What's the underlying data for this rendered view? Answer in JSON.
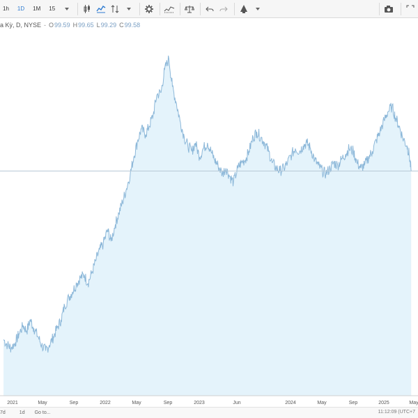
{
  "toolbar": {
    "intervals": [
      "1h",
      "1D",
      "1M",
      "15"
    ],
    "active_interval": "1D"
  },
  "legend": {
    "symbol": "a Kỳ, D, NYSE",
    "dash": "-",
    "open_label": "O",
    "open": "99.59",
    "high_label": "H",
    "high": "99.65",
    "low_label": "L",
    "low": "99.29",
    "close_label": "C",
    "close": "99.58"
  },
  "chart_data": {
    "type": "area",
    "x_tick_labels": [
      "2021",
      "May",
      "Sep",
      "2022",
      "May",
      "Sep",
      "2023",
      "Jun",
      "2024",
      "May",
      "Sep",
      "2025",
      "May"
    ],
    "x_range": [
      "2020-11",
      "2025-05"
    ],
    "y_axis_visible": false,
    "series": [
      {
        "x": [
          "2020-11-15",
          "2020-12-01",
          "2020-12-15",
          "2021-01-01",
          "2021-01-15",
          "2021-02-01",
          "2021-02-15",
          "2021-03-01",
          "2021-03-15",
          "2021-04-01",
          "2021-04-15",
          "2021-05-01",
          "2021-05-15",
          "2021-06-01",
          "2021-06-15",
          "2021-07-01",
          "2021-07-15",
          "2021-08-01",
          "2021-08-15",
          "2021-09-01",
          "2021-09-15",
          "2021-10-01",
          "2021-10-15",
          "2021-11-01",
          "2021-11-15",
          "2021-12-01",
          "2021-12-15",
          "2022-01-01",
          "2022-01-15",
          "2022-02-01",
          "2022-02-15",
          "2022-03-01",
          "2022-03-15",
          "2022-04-01",
          "2022-04-15",
          "2022-05-01",
          "2022-05-15",
          "2022-06-01",
          "2022-06-15",
          "2022-07-01",
          "2022-07-15",
          "2022-08-01",
          "2022-08-15",
          "2022-09-01",
          "2022-09-15",
          "2022-10-01",
          "2022-10-15",
          "2022-11-01",
          "2022-11-15",
          "2022-12-01",
          "2022-12-15",
          "2023-01-01",
          "2023-01-15",
          "2023-02-01",
          "2023-02-15",
          "2023-03-01",
          "2023-03-15",
          "2023-04-01",
          "2023-04-15",
          "2023-05-01",
          "2023-05-15",
          "2023-06-01",
          "2023-06-15",
          "2023-07-01",
          "2023-07-15",
          "2023-08-01",
          "2023-08-15",
          "2023-09-01",
          "2023-09-15",
          "2023-10-01",
          "2023-10-15",
          "2023-11-01",
          "2023-11-15",
          "2023-12-01",
          "2023-12-15",
          "2024-01-01",
          "2024-01-15",
          "2024-02-01",
          "2024-02-15",
          "2024-03-01",
          "2024-03-15",
          "2024-04-01",
          "2024-04-15",
          "2024-05-01",
          "2024-05-15",
          "2024-06-01",
          "2024-06-15",
          "2024-07-01",
          "2024-07-15",
          "2024-08-01",
          "2024-08-15",
          "2024-09-01",
          "2024-09-15",
          "2024-10-01",
          "2024-10-15",
          "2024-11-01",
          "2024-11-15",
          "2024-12-01",
          "2024-12-15",
          "2025-01-01",
          "2025-01-15",
          "2025-02-01",
          "2025-02-15",
          "2025-03-01",
          "2025-03-15",
          "2025-04-01",
          "2025-04-10",
          "2025-04-18"
        ],
        "values": [
          40,
          38,
          37,
          39,
          42,
          45,
          43,
          47,
          44,
          41,
          38,
          36,
          38,
          41,
          44,
          47,
          52,
          55,
          57,
          60,
          62,
          63,
          60,
          64,
          68,
          72,
          74,
          79,
          75,
          81,
          85,
          89,
          93,
          99,
          105,
          111,
          115,
          113,
          116,
          120,
          127,
          128,
          136,
          140,
          130,
          124,
          118,
          112,
          109,
          107,
          110,
          105,
          108,
          110,
          107,
          104,
          102,
          99,
          101,
          98,
          96,
          101,
          103,
          104,
          107,
          112,
          114,
          112,
          110,
          107,
          103,
          101,
          100,
          101,
          103,
          106,
          108,
          107,
          109,
          110,
          108,
          104,
          102,
          100,
          99,
          101,
          103,
          102,
          104,
          106,
          108,
          107,
          103,
          101,
          102,
          105,
          107,
          111,
          114,
          118,
          121,
          123,
          119,
          116,
          112,
          109,
          106,
          100
        ]
      }
    ]
  },
  "bottom_bar": {
    "range_label": "7d",
    "interval_label": "1d",
    "goto_label": "Go to...",
    "time": "11:12:09 (UTC+7"
  },
  "colors": {
    "line": "#8db8d9",
    "fill": "#e4f3fb",
    "accent": "#2e7bd1"
  }
}
